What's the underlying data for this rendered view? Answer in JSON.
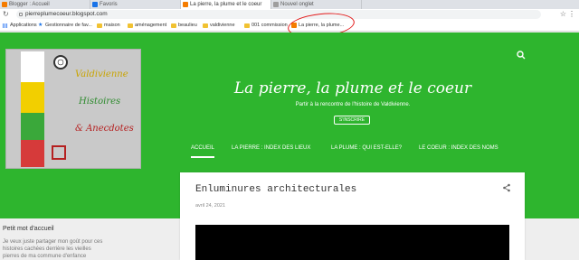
{
  "browser": {
    "tabs": [
      {
        "label": "Blogger : Accueil",
        "favicon_color": "#f57c00"
      },
      {
        "label": "Favoris",
        "favicon_color": "#1a73e8"
      },
      {
        "label": "La pierre, la plume et le coeur",
        "favicon_color": "#f57c00"
      },
      {
        "label": "Nouvel onglet",
        "favicon_color": "#9e9e9e"
      }
    ],
    "url": "pierreplumecoeur.blogspot.com",
    "nav_icons": [
      "back-icon",
      "forward-icon",
      "reload-icon"
    ],
    "bookmarks": [
      {
        "label": "Applications",
        "icon": "apps-icon"
      },
      {
        "label": "Gestionnaire de fav...",
        "icon": "star-icon"
      },
      {
        "label": "maison",
        "icon": "folder-icon"
      },
      {
        "label": "aménagement",
        "icon": "folder-icon"
      },
      {
        "label": "beaulieu",
        "icon": "folder-icon"
      },
      {
        "label": "valdivienne",
        "icon": "folder-icon"
      },
      {
        "label": "001 commission",
        "icon": "folder-icon"
      },
      {
        "label": "La pierre, la plume...",
        "icon": "blogger-icon"
      }
    ]
  },
  "blog": {
    "header_color": "#2eb52e",
    "logo": {
      "line1": "Valdivienne",
      "line2": "Histoires",
      "line3": "& Anecdotes"
    },
    "title": "La pierre, la plume et le coeur",
    "subtitle": "Partir à la rencontre de l'histoire de Valdivienne.",
    "subscribe_label": "S'INSCRIRE",
    "nav": [
      {
        "label": "ACCUEIL",
        "active": true
      },
      {
        "label": "LA PIERRE : INDEX DES LIEUX",
        "active": false
      },
      {
        "label": "LA PLUME : QUI EST-ELLE?",
        "active": false
      },
      {
        "label": "LE COEUR : INDEX DES NOMS",
        "active": false
      }
    ],
    "post": {
      "title": "Enluminures architecturales",
      "date": "avril 24, 2021"
    },
    "sidebar": {
      "title": "Petit mot d'accueil",
      "text": "Je veux juste partager mon goût pour ces histoires cachées derrière les vieilles pierres de ma commune d'enfance"
    }
  }
}
